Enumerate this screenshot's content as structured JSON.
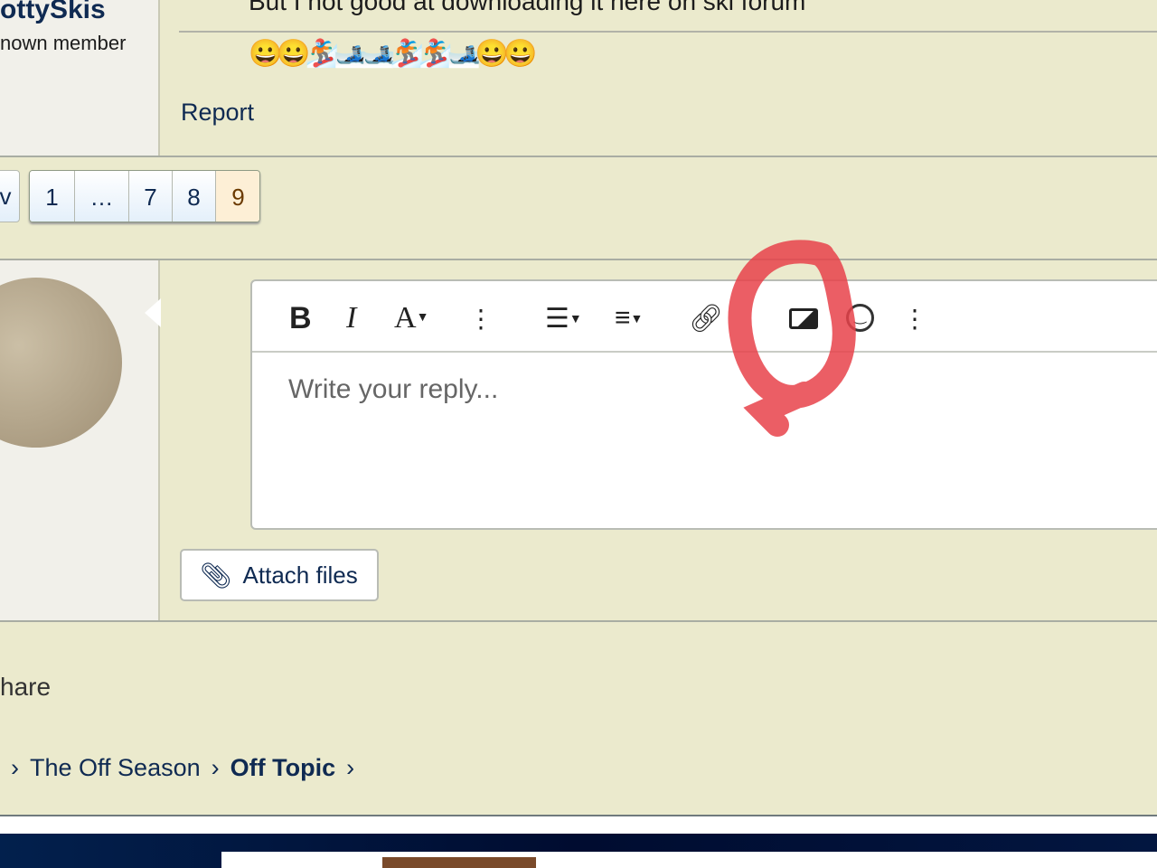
{
  "post": {
    "username": "ottySkis",
    "user_title": "nown member",
    "text": "But I not good at downloading it here on ski forum",
    "emojis": "😀😀🏂🎿🎿🏂🏂🎿😀😀",
    "report_label": "Report"
  },
  "pagination": {
    "prev": "v",
    "pages": [
      "1",
      "…",
      "7",
      "8",
      "9"
    ],
    "current": "9"
  },
  "editor": {
    "placeholder": "Write your reply...",
    "toolbar": [
      "bold",
      "italic",
      "font-size",
      "more",
      "list",
      "align",
      "link",
      "image",
      "emoji",
      "more"
    ],
    "attach_label": "Attach files"
  },
  "share_label": "hare",
  "breadcrumb": [
    "The Off Season",
    "Off Topic"
  ],
  "colors": {
    "annotation": "#e8424a",
    "link": "#0f2a52",
    "footer": "#021640"
  }
}
